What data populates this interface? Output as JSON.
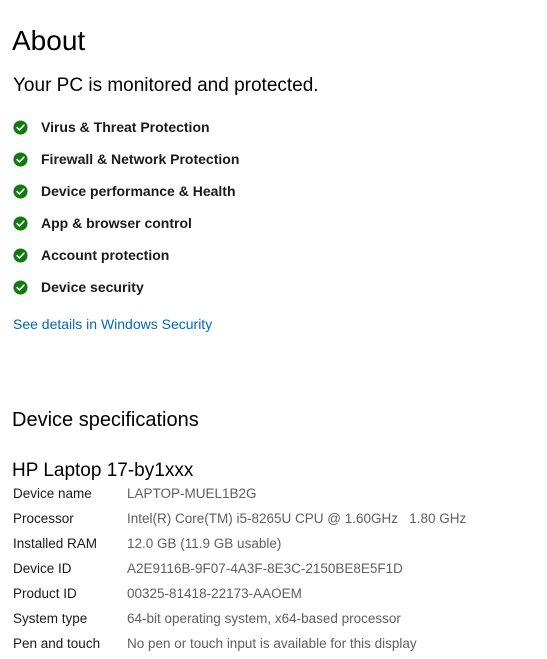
{
  "page": {
    "title": "About"
  },
  "protection": {
    "status_heading": "Your PC is monitored and protected.",
    "items": [
      {
        "label": "Virus & Threat Protection",
        "icon": "check-circle-icon"
      },
      {
        "label": "Firewall & Network Protection",
        "icon": "check-circle-icon"
      },
      {
        "label": "Device performance & Health",
        "icon": "check-circle-icon"
      },
      {
        "label": "App & browser control",
        "icon": "check-circle-icon"
      },
      {
        "label": "Account protection",
        "icon": "check-circle-icon"
      },
      {
        "label": "Device security",
        "icon": "check-circle-icon"
      }
    ],
    "link_label": "See details in Windows Security"
  },
  "device_specs": {
    "heading": "Device specifications",
    "model": "HP Laptop 17-by1xxx",
    "rows": [
      {
        "label": "Device name",
        "value": "LAPTOP-MUEL1B2G"
      },
      {
        "label": "Processor",
        "value": "Intel(R) Core(TM) i5-8265U CPU @ 1.60GHz   1.80 GHz"
      },
      {
        "label": "Installed RAM",
        "value": "12.0 GB (11.9 GB usable)"
      },
      {
        "label": "Device ID",
        "value": "A2E9116B-9F07-4A3F-8E3C-2150BE8E5F1D"
      },
      {
        "label": "Product ID",
        "value": "00325-81418-22173-AAOEM"
      },
      {
        "label": "System type",
        "value": "64-bit operating system, x64-based processor"
      },
      {
        "label": "Pen and touch",
        "value": "No pen or touch input is available for this display"
      }
    ]
  },
  "colors": {
    "check_green": "#0f7b0f",
    "link_blue": "#0067c0",
    "value_gray": "#5f5f5f"
  }
}
